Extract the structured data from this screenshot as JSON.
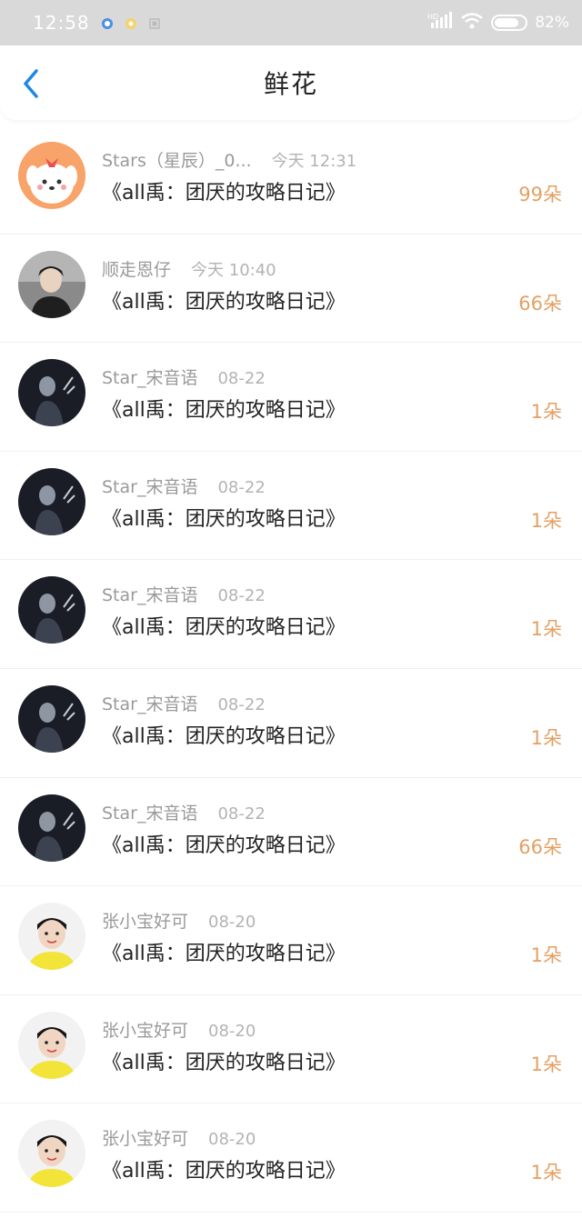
{
  "status_bar": {
    "time": "12:58",
    "battery_text": "82%",
    "battery_level": 0.82,
    "icons": [
      "notification-icon",
      "app-icon",
      "image-icon",
      "hd-signal-icon",
      "wifi-icon",
      "battery-icon"
    ]
  },
  "header": {
    "back_icon": "chevron-left-icon",
    "title": "鲜花"
  },
  "colors": {
    "accent": "#1e88e5",
    "count": "#e3a064",
    "status_bar_bg": "#d9d9d9"
  },
  "items": [
    {
      "user": "Stars（星辰）_0...",
      "time": "今天 12:31",
      "title": "《all禹：团厌的攻略日记》",
      "count": "99朵",
      "avatar": "cartoon-dog-avatar"
    },
    {
      "user": "顺走恩仔",
      "time": "今天 10:40",
      "title": "《all禹：团厌的攻略日记》",
      "count": "66朵",
      "avatar": "person-avatar"
    },
    {
      "user": "Star_宋音语",
      "time": "08-22",
      "title": "《all禹：团厌的攻略日记》",
      "count": "1朵",
      "avatar": "dark-portrait-avatar"
    },
    {
      "user": "Star_宋音语",
      "time": "08-22",
      "title": "《all禹：团厌的攻略日记》",
      "count": "1朵",
      "avatar": "dark-portrait-avatar"
    },
    {
      "user": "Star_宋音语",
      "time": "08-22",
      "title": "《all禹：团厌的攻略日记》",
      "count": "1朵",
      "avatar": "dark-portrait-avatar"
    },
    {
      "user": "Star_宋音语",
      "time": "08-22",
      "title": "《all禹：团厌的攻略日记》",
      "count": "1朵",
      "avatar": "dark-portrait-avatar"
    },
    {
      "user": "Star_宋音语",
      "time": "08-22",
      "title": "《all禹：团厌的攻略日记》",
      "count": "66朵",
      "avatar": "dark-portrait-avatar"
    },
    {
      "user": "张小宝好可",
      "time": "08-20",
      "title": "《all禹：团厌的攻略日记》",
      "count": "1朵",
      "avatar": "boy-portrait-avatar"
    },
    {
      "user": "张小宝好可",
      "time": "08-20",
      "title": "《all禹：团厌的攻略日记》",
      "count": "1朵",
      "avatar": "boy-portrait-avatar"
    },
    {
      "user": "张小宝好可",
      "time": "08-20",
      "title": "《all禹：团厌的攻略日记》",
      "count": "1朵",
      "avatar": "boy-portrait-avatar"
    }
  ]
}
